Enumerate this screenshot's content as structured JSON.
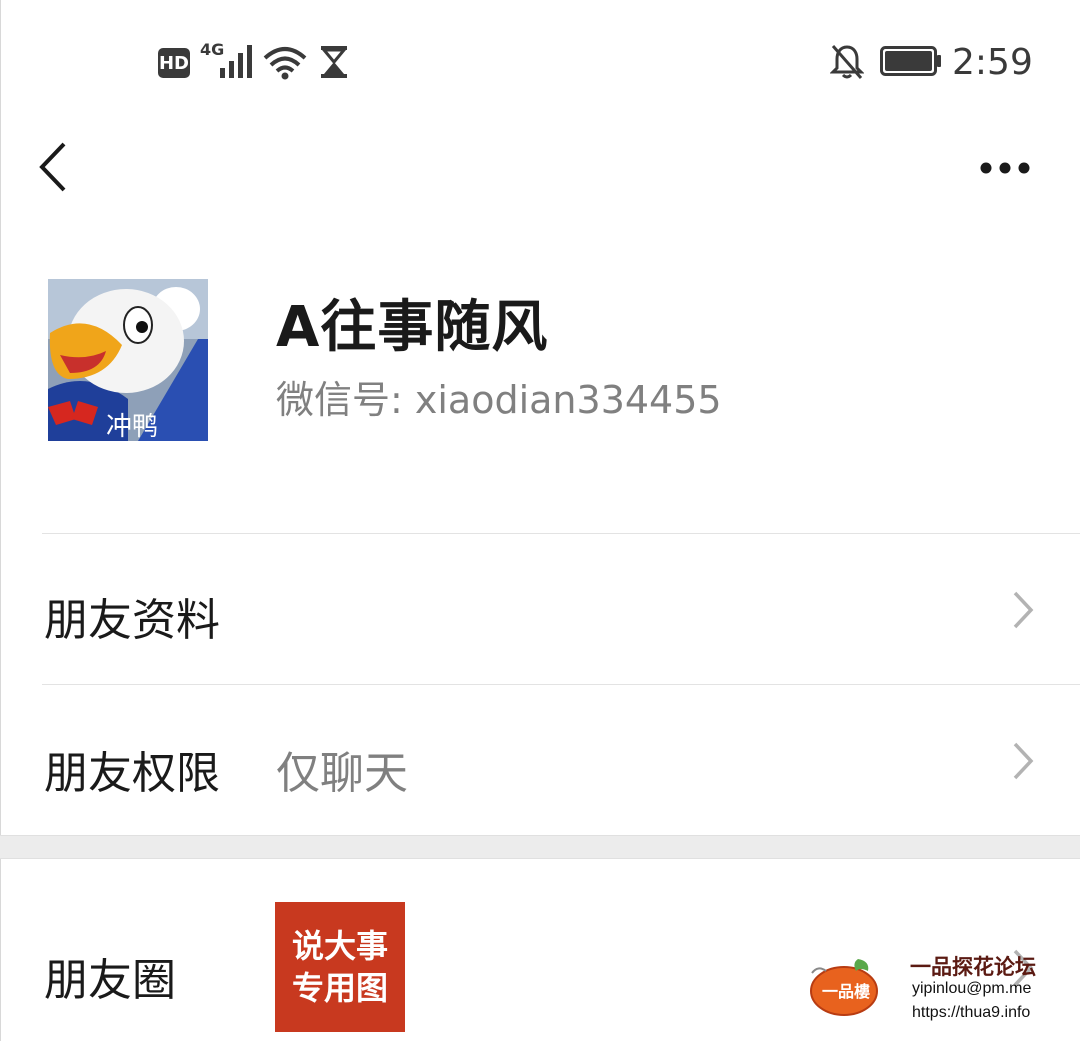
{
  "status_bar": {
    "hd_label": "HD",
    "network_label": "4G",
    "time": "2:59",
    "icons": [
      "hd-icon",
      "signal-icon",
      "wifi-icon",
      "hourglass-icon",
      "bell-muted-icon",
      "battery-icon"
    ]
  },
  "nav": {
    "back_icon": "chevron-left-icon",
    "more_icon": "more-dots-icon"
  },
  "profile": {
    "avatar_caption": "冲鸭",
    "name": "A往事随风",
    "wechat_id": "微信号: xiaodian334455"
  },
  "rows": {
    "friend_info": {
      "label": "朋友资料"
    },
    "friend_permission": {
      "label": "朋友权限",
      "value": "仅聊天"
    },
    "moments": {
      "label": "朋友圈",
      "thumb_line1": "说大事",
      "thumb_line2": "专用图"
    }
  },
  "watermark": {
    "logo_text": "一品樓",
    "title": "一品探花论坛",
    "email": "yipinlou@pm.me",
    "url": "https://thua9.info"
  },
  "colors": {
    "primary_text": "#1a1a1a",
    "secondary_text": "#808080",
    "divider": "#e3e3e3",
    "section_gap": "#ececec",
    "chevron": "#b3b3b3",
    "thumb_bg": "#c8391f"
  }
}
